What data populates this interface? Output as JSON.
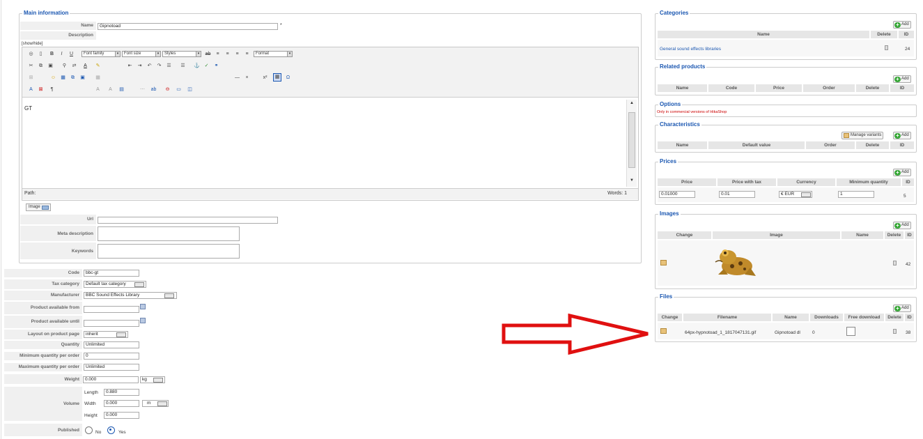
{
  "main_info": {
    "legend": "Main information",
    "name_label": "Name",
    "name_value": "Gipnotoad",
    "required_mark": "*",
    "description_label": "Description",
    "show_hide": "[show/hide]",
    "editor": {
      "font_family": "Font family",
      "font_size": "Font size",
      "styles": "Styles",
      "format": "Format",
      "content": "GT",
      "path_label": "Path:",
      "words": "Words: 1"
    },
    "image_button": "Image",
    "url_label": "Url",
    "meta_description_label": "Meta description",
    "keywords_label": "Keywords"
  },
  "product": {
    "code_label": "Code",
    "code_value": "bbc-gt",
    "tax_label": "Tax category",
    "tax_value": "Default tax category",
    "manufacturer_label": "Manufacturer",
    "manufacturer_value": "BBC Sound Effects Library",
    "available_from_label": "Product available from",
    "available_until_label": "Product available until",
    "layout_label": "Layout on product page",
    "layout_value": "inherit",
    "quantity_label": "Quantity",
    "quantity_value": "Unlimited",
    "min_qty_label": "Minimum quantity per order",
    "min_qty_value": "0",
    "max_qty_label": "Maximum quantity per order",
    "max_qty_value": "Unlimited",
    "weight_label": "Weight",
    "weight_value": "0.000",
    "weight_unit": "kg",
    "volume_label": "Volume",
    "length_label": "Length",
    "length_value": "0.880",
    "width_label": "Width",
    "width_value": "0.000",
    "height_label": "Height",
    "height_value": "0.000",
    "volume_unit": "m",
    "published_label": "Published",
    "no_label": "No",
    "yes_label": "Yes",
    "published": "Yes"
  },
  "categories": {
    "legend": "Categories",
    "add": "Add",
    "headers": [
      "Name",
      "Delete",
      "ID"
    ],
    "rows": [
      {
        "name": "General sound effects libraries",
        "id": "24"
      }
    ]
  },
  "related": {
    "legend": "Related products",
    "add": "Add",
    "headers": [
      "Name",
      "Code",
      "Price",
      "Order",
      "Delete",
      "ID"
    ]
  },
  "options": {
    "legend": "Options",
    "note": "Only in commercial versions of HikaShop"
  },
  "characteristics": {
    "legend": "Characteristics",
    "manage": "Manage variants",
    "add": "Add",
    "headers": [
      "Name",
      "Default value",
      "Order",
      "Delete",
      "ID"
    ]
  },
  "prices": {
    "legend": "Prices",
    "add": "Add",
    "headers": [
      "Price",
      "Price with tax",
      "Currency",
      "Minimum quantity",
      "ID"
    ],
    "row": {
      "price": "0.01000",
      "price_tax": "0.01",
      "currency": "€ EUR",
      "min_qty": "1",
      "id": "5"
    }
  },
  "images": {
    "legend": "Images",
    "add": "Add",
    "headers": [
      "Change",
      "Image",
      "Name",
      "Delete",
      "ID"
    ],
    "row": {
      "id": "42"
    }
  },
  "files": {
    "legend": "Files",
    "add": "Add",
    "headers": [
      "Change",
      "Filename",
      "Name",
      "Downloads",
      "Free download",
      "Delete",
      "ID"
    ],
    "row": {
      "filename": "64px-hypnotoad_1_1817047131.gif",
      "name": "Gipnotoad dl",
      "downloads": "0",
      "id": "38"
    }
  },
  "colors": {
    "accent": "#1b57b1",
    "arrow": "#e01010",
    "note": "#cc0000"
  }
}
